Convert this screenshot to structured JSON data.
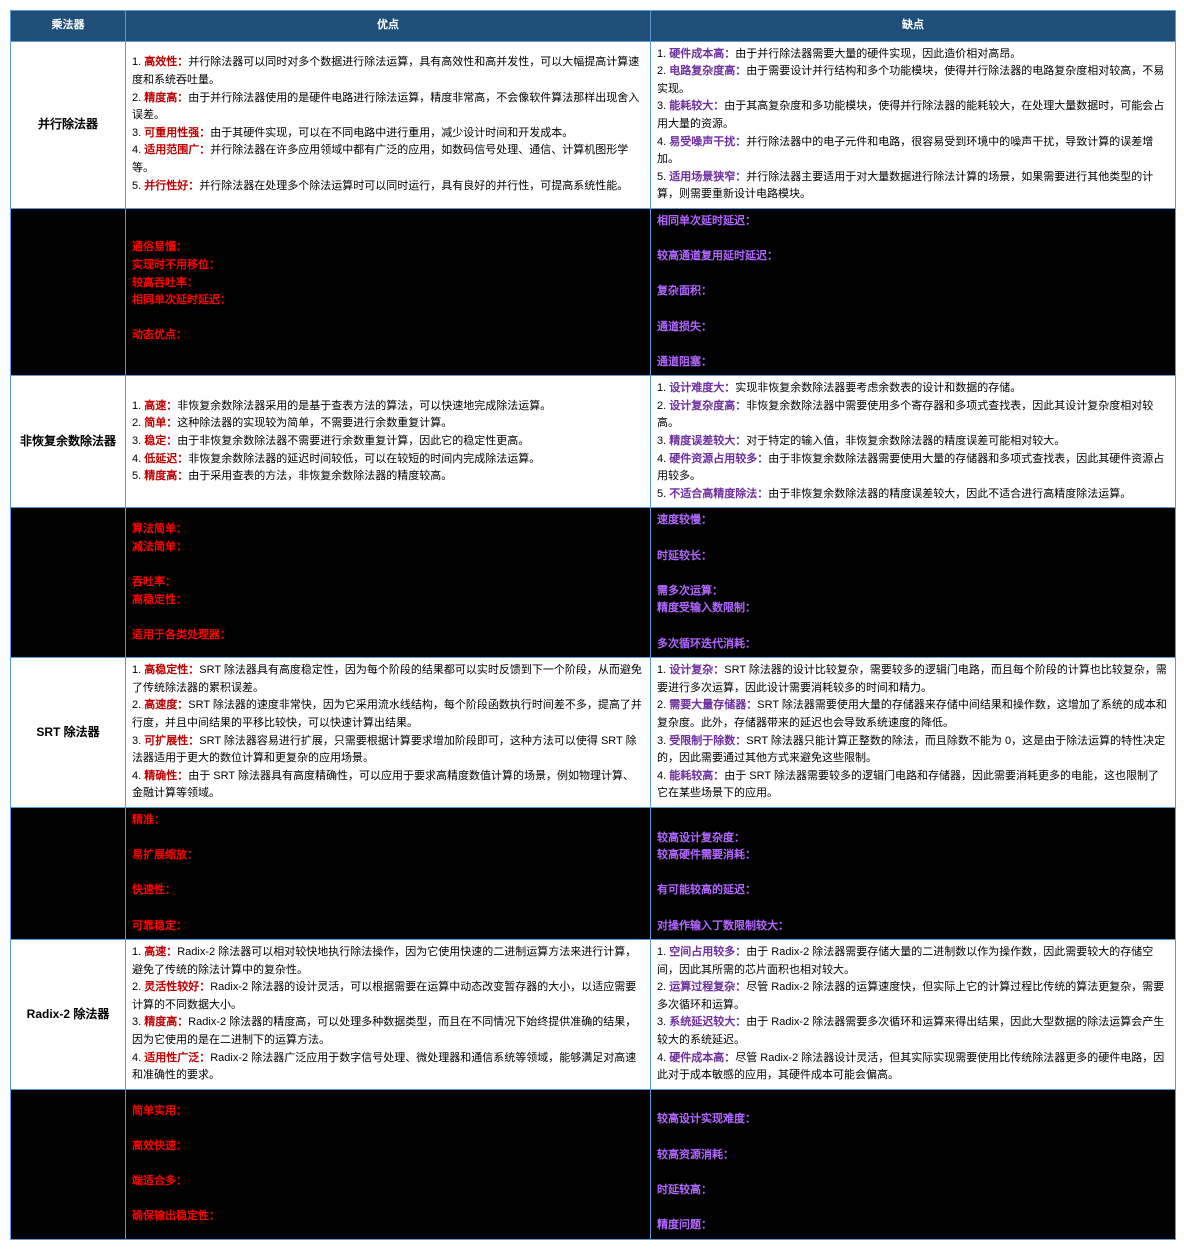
{
  "headers": {
    "col1": "乘法器",
    "col2": "优点",
    "col3": "缺点"
  },
  "rows": [
    {
      "dark": false,
      "name": "并行除法器",
      "adv": [
        {
          "n": "1",
          "k": "高效性",
          "kc": "red",
          "t": "并行除法器可以同时对多个数据进行除法运算，具有高效性和高并发性，可以大幅提高计算速度和系统吞吐量。"
        },
        {
          "n": "2",
          "k": "精度高",
          "kc": "red",
          "t": "由于并行除法器使用的是硬件电路进行除法运算，精度非常高，不会像软件算法那样出现舍入误差。"
        },
        {
          "n": "3",
          "k": "可重用性强",
          "kc": "red",
          "t": "由于其硬件实现，可以在不同电路中进行重用，减少设计时间和开发成本。"
        },
        {
          "n": "4",
          "k": "适用范围广",
          "kc": "red",
          "t": "并行除法器在许多应用领域中都有广泛的应用，如数码信号处理、通信、计算机图形学等。"
        },
        {
          "n": "5",
          "k": "并行性好",
          "kc": "red",
          "t": "并行除法器在处理多个除法运算时可以同时运行，具有良好的并行性，可提高系统性能。"
        }
      ],
      "dis": [
        {
          "n": "1",
          "k": "硬件成本高",
          "kc": "purple",
          "t": "由于并行除法器需要大量的硬件实现，因此造价相对高昂。"
        },
        {
          "n": "2",
          "k": "电路复杂度高",
          "kc": "purple",
          "t": "由于需要设计并行结构和多个功能模块，使得并行除法器的电路复杂度相对较高，不易实现。"
        },
        {
          "n": "3",
          "k": "能耗较大",
          "kc": "purple",
          "t": "由于其高复杂度和多功能模块，使得并行除法器的能耗较大，在处理大量数据时，可能会占用大量的资源。"
        },
        {
          "n": "4",
          "k": "易受噪声干扰",
          "kc": "purple",
          "t": "并行除法器中的电子元件和电路，很容易受到环境中的噪声干扰，导致计算的误差增加。"
        },
        {
          "n": "5",
          "k": "适用场景狭窄",
          "kc": "purple",
          "t": "并行除法器主要适用于对大量数据进行除法计算的场景，如果需要进行其他类型的计算，则需要重新设计电路模块。"
        }
      ]
    },
    {
      "dark": true,
      "name": "",
      "adv": [
        {
          "n": "",
          "k": "通俗易懂：",
          "kc": "red",
          "t": ""
        },
        {
          "n": "",
          "k": "实现时不用移位：",
          "kc": "red",
          "t": ""
        },
        {
          "n": "",
          "k": "较高吞吐率：",
          "kc": "red",
          "t": ""
        },
        {
          "n": "",
          "k": "相同单次延时延迟：",
          "kc": "red",
          "t": ""
        },
        {
          "n": "",
          "k": "",
          "kc": "red",
          "t": ""
        },
        {
          "n": "",
          "k": "动态优点：",
          "kc": "red",
          "t": ""
        }
      ],
      "dis": [
        {
          "n": "",
          "k": "相同单次延时延迟：",
          "kc": "purple",
          "t": ""
        },
        {
          "n": "",
          "k": "",
          "kc": "purple",
          "t": ""
        },
        {
          "n": "",
          "k": "较高通道复用延时延迟：",
          "kc": "purple",
          "t": ""
        },
        {
          "n": "",
          "k": "",
          "kc": "purple",
          "t": ""
        },
        {
          "n": "",
          "k": "复杂面积：",
          "kc": "purple",
          "t": ""
        },
        {
          "n": "",
          "k": "",
          "kc": "purple",
          "t": ""
        },
        {
          "n": "",
          "k": "通道损失：",
          "kc": "purple",
          "t": ""
        },
        {
          "n": "",
          "k": "",
          "kc": "purple",
          "t": ""
        },
        {
          "n": "",
          "k": "通道阻塞：",
          "kc": "purple",
          "t": ""
        }
      ]
    },
    {
      "dark": false,
      "name": "非恢复余数除法器",
      "adv": [
        {
          "n": "1",
          "k": "高速",
          "kc": "red",
          "t": "非恢复余数除法器采用的是基于查表方法的算法，可以快速地完成除法运算。"
        },
        {
          "n": "2",
          "k": "简单",
          "kc": "red",
          "t": "这种除法器的实现较为简单，不需要进行余数重复计算。"
        },
        {
          "n": "3",
          "k": "稳定",
          "kc": "red",
          "t": "由于非恢复余数除法器不需要进行余数重复计算，因此它的稳定性更高。"
        },
        {
          "n": "4",
          "k": "低延迟",
          "kc": "red",
          "t": "非恢复余数除法器的延迟时间较低，可以在较短的时间内完成除法运算。"
        },
        {
          "n": "5",
          "k": "精度高",
          "kc": "red",
          "t": "由于采用查表的方法，非恢复余数除法器的精度较高。"
        }
      ],
      "dis": [
        {
          "n": "1",
          "k": "设计难度大",
          "kc": "purple",
          "t": "实现非恢复余数除法器要考虑余数表的设计和数据的存储。"
        },
        {
          "n": "2",
          "k": "设计复杂度高",
          "kc": "purple",
          "t": "非恢复余数除法器中需要使用多个寄存器和多项式查找表，因此其设计复杂度相对较高。"
        },
        {
          "n": "3",
          "k": "精度误差较大",
          "kc": "purple",
          "t": "对于特定的输入值，非恢复余数除法器的精度误差可能相对较大。"
        },
        {
          "n": "4",
          "k": "硬件资源占用较多",
          "kc": "purple",
          "t": "由于非恢复余数除法器需要使用大量的存储器和多项式查找表，因此其硬件资源占用较多。"
        },
        {
          "n": "5",
          "k": "不适合高精度除法",
          "kc": "purple",
          "t": "由于非恢复余数除法器的精度误差较大，因此不适合进行高精度除法运算。"
        }
      ]
    },
    {
      "dark": true,
      "name": "",
      "adv": [
        {
          "n": "",
          "k": "算法简单：",
          "kc": "red",
          "t": ""
        },
        {
          "n": "",
          "k": "减法简单：",
          "kc": "red",
          "t": ""
        },
        {
          "n": "",
          "k": "",
          "kc": "red",
          "t": ""
        },
        {
          "n": "",
          "k": "吞吐率：",
          "kc": "red",
          "t": ""
        },
        {
          "n": "",
          "k": "高稳定性：",
          "kc": "red",
          "t": ""
        },
        {
          "n": "",
          "k": "",
          "kc": "red",
          "t": ""
        },
        {
          "n": "",
          "k": "适用于各类处理器：",
          "kc": "red",
          "t": ""
        }
      ],
      "dis": [
        {
          "n": "",
          "k": "速度较慢：",
          "kc": "purple",
          "t": ""
        },
        {
          "n": "",
          "k": "",
          "kc": "purple",
          "t": ""
        },
        {
          "n": "",
          "k": "时延较长：",
          "kc": "purple",
          "t": ""
        },
        {
          "n": "",
          "k": "",
          "kc": "purple",
          "t": ""
        },
        {
          "n": "",
          "k": "需多次运算：",
          "kc": "purple",
          "t": ""
        },
        {
          "n": "",
          "k": "精度受输入数限制：",
          "kc": "purple",
          "t": ""
        },
        {
          "n": "",
          "k": "",
          "kc": "purple",
          "t": ""
        },
        {
          "n": "",
          "k": "多次循环迭代消耗：",
          "kc": "purple",
          "t": ""
        }
      ]
    },
    {
      "dark": false,
      "name": "SRT 除法器",
      "adv": [
        {
          "n": "1",
          "k": "高稳定性",
          "kc": "red",
          "t": "SRT 除法器具有高度稳定性，因为每个阶段的结果都可以实时反馈到下一个阶段，从而避免了传统除法器的累积误差。"
        },
        {
          "n": "2",
          "k": "高速度",
          "kc": "red",
          "t": "SRT 除法器的速度非常快，因为它采用流水线结构，每个阶段函数执行时间差不多，提高了并行度，并且中间结果的平移比较快，可以快速计算出结果。"
        },
        {
          "n": "3",
          "k": "可扩展性",
          "kc": "red",
          "t": "SRT 除法器容易进行扩展，只需要根据计算要求增加阶段即可，这种方法可以使得 SRT 除法器适用于更大的数位计算和更复杂的应用场景。"
        },
        {
          "n": "4",
          "k": "精确性",
          "kc": "red",
          "t": "由于 SRT 除法器具有高度精确性，可以应用于要求高精度数值计算的场景，例如物理计算、金融计算等领域。"
        }
      ],
      "dis": [
        {
          "n": "1",
          "k": "设计复杂",
          "kc": "purple",
          "t": "SRT 除法器的设计比较复杂，需要较多的逻辑门电路，而且每个阶段的计算也比较复杂，需要进行多次运算，因此设计需要消耗较多的时间和精力。"
        },
        {
          "n": "2",
          "k": "需要大量存储器",
          "kc": "purple",
          "t": "SRT 除法器需要使用大量的存储器来存储中间结果和操作数，这增加了系统的成本和复杂度。此外，存储器带来的延迟也会导致系统速度的降低。"
        },
        {
          "n": "3",
          "k": "受限制于除数",
          "kc": "purple",
          "t": "SRT 除法器只能计算正整数的除法，而且除数不能为 0，这是由于除法运算的特性决定的，因此需要通过其他方式来避免这些限制。"
        },
        {
          "n": "4",
          "k": "能耗较高",
          "kc": "purple",
          "t": "由于 SRT 除法器需要较多的逻辑门电路和存储器，因此需要消耗更多的电能，这也限制了它在某些场景下的应用。"
        }
      ]
    },
    {
      "dark": true,
      "name": "",
      "adv": [
        {
          "n": "",
          "k": "精准：",
          "kc": "red",
          "t": ""
        },
        {
          "n": "",
          "k": "",
          "kc": "red",
          "t": ""
        },
        {
          "n": "",
          "k": "易扩展缩放：",
          "kc": "red",
          "t": ""
        },
        {
          "n": "",
          "k": "",
          "kc": "red",
          "t": ""
        },
        {
          "n": "",
          "k": "快速性：",
          "kc": "red",
          "t": ""
        },
        {
          "n": "",
          "k": "",
          "kc": "red",
          "t": ""
        },
        {
          "n": "",
          "k": "可靠稳定：",
          "kc": "red",
          "t": ""
        }
      ],
      "dis": [
        {
          "n": "",
          "k": "",
          "kc": "purple",
          "t": ""
        },
        {
          "n": "",
          "k": "较高设计复杂度：",
          "kc": "purple",
          "t": ""
        },
        {
          "n": "",
          "k": "较高硬件需要消耗：",
          "kc": "purple",
          "t": ""
        },
        {
          "n": "",
          "k": "",
          "kc": "purple",
          "t": ""
        },
        {
          "n": "",
          "k": "有可能较高的延迟：",
          "kc": "purple",
          "t": ""
        },
        {
          "n": "",
          "k": "",
          "kc": "purple",
          "t": ""
        },
        {
          "n": "",
          "k": "对操作输入丁数限制较大：",
          "kc": "purple",
          "t": ""
        }
      ]
    },
    {
      "dark": false,
      "name": "Radix-2 除法器",
      "adv": [
        {
          "n": "1",
          "k": "高速",
          "kc": "red",
          "t": "Radix-2 除法器可以相对较快地执行除法操作，因为它使用快速的二进制运算方法来进行计算，避免了传统的除法计算中的复杂性。"
        },
        {
          "n": "2",
          "k": "灵活性较好",
          "kc": "red",
          "t": "Radix-2 除法器的设计灵活，可以根据需要在运算中动态改变暂存器的大小，以适应需要计算的不同数据大小。"
        },
        {
          "n": "3",
          "k": "精度高",
          "kc": "red",
          "t": "Radix-2 除法器的精度高，可以处理多种数据类型，而且在不同情况下始终提供准确的结果，因为它使用的是在二进制下的运算方法。"
        },
        {
          "n": "4",
          "k": "适用性广泛",
          "kc": "red",
          "t": "Radix-2 除法器广泛应用于数字信号处理、微处理器和通信系统等领域，能够满足对高速和准确性的要求。"
        }
      ],
      "dis": [
        {
          "n": "1",
          "k": "空间占用较多",
          "kc": "purple",
          "t": "由于 Radix-2 除法器需要存储大量的二进制数以作为操作数，因此需要较大的存储空间，因此其所需的芯片面积也相对较大。"
        },
        {
          "n": "2",
          "k": "运算过程复杂",
          "kc": "purple",
          "t": "尽管 Radix-2 除法器的运算速度快，但实际上它的计算过程比传统的算法更复杂，需要多次循环和运算。"
        },
        {
          "n": "3",
          "k": "系统延迟较大",
          "kc": "purple",
          "t": "由于 Radix-2 除法器需要多次循环和运算来得出结果，因此大型数据的除法运算会产生较大的系统延迟。"
        },
        {
          "n": "4",
          "k": "硬件成本高",
          "kc": "purple",
          "t": "尽管 Radix-2 除法器设计灵活，但其实际实现需要使用比传统除法器更多的硬件电路，因此对于成本敏感的应用，其硬件成本可能会偏高。"
        }
      ]
    },
    {
      "dark": true,
      "name": "",
      "adv": [
        {
          "n": "",
          "k": "简单实用：",
          "kc": "red",
          "t": ""
        },
        {
          "n": "",
          "k": "",
          "kc": "red",
          "t": ""
        },
        {
          "n": "",
          "k": "高效快速：",
          "kc": "red",
          "t": ""
        },
        {
          "n": "",
          "k": "",
          "kc": "red",
          "t": ""
        },
        {
          "n": "",
          "k": "端适合多：",
          "kc": "red",
          "t": ""
        },
        {
          "n": "",
          "k": "",
          "kc": "red",
          "t": ""
        },
        {
          "n": "",
          "k": "确保输出稳定性：",
          "kc": "red",
          "t": ""
        }
      ],
      "dis": [
        {
          "n": "",
          "k": "",
          "kc": "purple",
          "t": ""
        },
        {
          "n": "",
          "k": "较高设计实现难度：",
          "kc": "purple",
          "t": ""
        },
        {
          "n": "",
          "k": "",
          "kc": "purple",
          "t": ""
        },
        {
          "n": "",
          "k": "较高资源消耗：",
          "kc": "purple",
          "t": ""
        },
        {
          "n": "",
          "k": "",
          "kc": "purple",
          "t": ""
        },
        {
          "n": "",
          "k": "时延较高：",
          "kc": "purple",
          "t": ""
        },
        {
          "n": "",
          "k": "",
          "kc": "purple",
          "t": ""
        },
        {
          "n": "",
          "k": "精度问题：",
          "kc": "purple",
          "t": ""
        }
      ]
    }
  ]
}
